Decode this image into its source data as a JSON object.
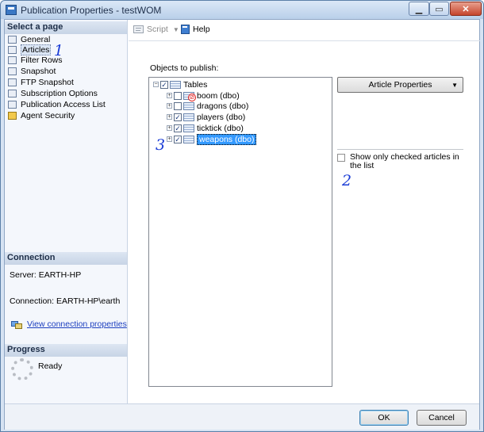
{
  "window": {
    "title": "Publication Properties - testWOM"
  },
  "select_page": {
    "header": "Select a page",
    "items": [
      {
        "label": "General",
        "icon": "properties-icon"
      },
      {
        "label": "Articles",
        "icon": "articles-icon"
      },
      {
        "label": "Filter Rows",
        "icon": "filter-icon"
      },
      {
        "label": "Snapshot",
        "icon": "snapshot-icon"
      },
      {
        "label": "FTP Snapshot",
        "icon": "ftp-snapshot-icon"
      },
      {
        "label": "Subscription Options",
        "icon": "subscription-icon"
      },
      {
        "label": "Publication Access List",
        "icon": "access-list-icon"
      },
      {
        "label": "Agent Security",
        "icon": "lock-icon"
      }
    ]
  },
  "annotations": {
    "one": "1",
    "two": "2",
    "three": "3"
  },
  "connection": {
    "header": "Connection",
    "server": "Server: EARTH-HP",
    "connection": "Connection: EARTH-HP\\earth",
    "link": "View connection properties"
  },
  "progress": {
    "header": "Progress",
    "status": "Ready"
  },
  "toolbar": {
    "script": "Script",
    "help": "Help"
  },
  "objects": {
    "label": "Objects to publish:",
    "root": {
      "label": "Tables",
      "checked": true
    },
    "tables": [
      {
        "label": "boom (dbo)",
        "checked": false,
        "error": true
      },
      {
        "label": "dragons (dbo)",
        "checked": false
      },
      {
        "label": "players (dbo)",
        "checked": true
      },
      {
        "label": "ticktick (dbo)",
        "checked": true
      },
      {
        "label": "weapons (dbo)",
        "checked": true,
        "selected": true
      }
    ]
  },
  "article_properties": "Article Properties",
  "show_checked_only": {
    "label": "Show only checked articles in the list",
    "checked": false
  },
  "buttons": {
    "ok": "OK",
    "cancel": "Cancel"
  },
  "colors": {
    "annotation": "#1a3cd6",
    "selection": "#3399ff"
  }
}
